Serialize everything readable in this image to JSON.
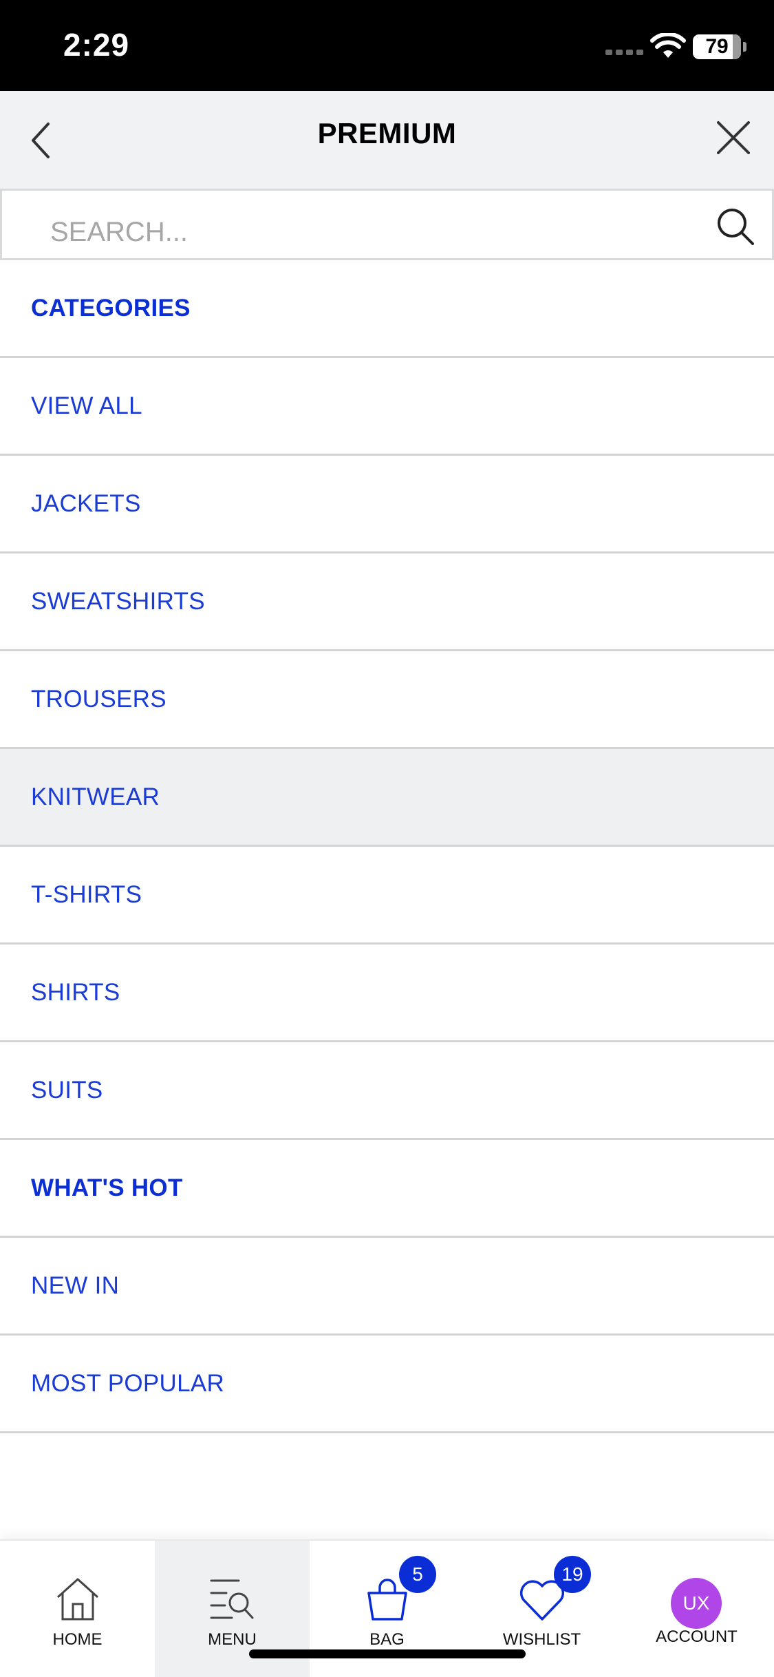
{
  "status_bar": {
    "time": "2:29",
    "battery": "79"
  },
  "header": {
    "title": "PREMIUM",
    "back_icon": "chevron-left-icon",
    "close_icon": "close-icon"
  },
  "search": {
    "placeholder": "SEARCH...",
    "value": ""
  },
  "menu": {
    "items": [
      {
        "label": "CATEGORIES",
        "heading": true
      },
      {
        "label": "VIEW ALL"
      },
      {
        "label": "JACKETS"
      },
      {
        "label": "SWEATSHIRTS"
      },
      {
        "label": "TROUSERS"
      },
      {
        "label": "KNITWEAR",
        "highlighted": true
      },
      {
        "label": "T-SHIRTS"
      },
      {
        "label": "SHIRTS"
      },
      {
        "label": "SUITS"
      },
      {
        "label": "WHAT'S HOT",
        "heading": true
      },
      {
        "label": "NEW IN"
      },
      {
        "label": "MOST POPULAR"
      }
    ]
  },
  "tabbar": {
    "home": {
      "label": "HOME",
      "icon": "home-icon"
    },
    "menu": {
      "label": "MENU",
      "icon": "menu-search-icon",
      "active": true
    },
    "bag": {
      "label": "BAG",
      "icon": "bag-icon",
      "badge": "5"
    },
    "wishlist": {
      "label": "WISHLIST",
      "icon": "heart-icon",
      "badge": "19"
    },
    "account": {
      "label": "ACCOUNT",
      "initials": "UX"
    }
  },
  "colors": {
    "accent": "#0b2fd4",
    "header_bg": "#f1f2f4",
    "account_avatar": "#b045e8"
  }
}
